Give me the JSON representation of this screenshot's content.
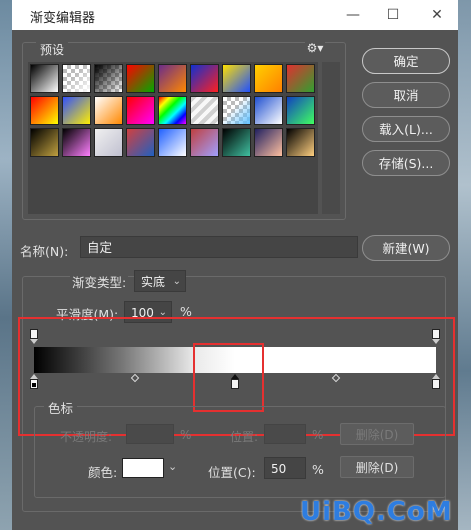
{
  "window": {
    "title": "渐变编辑器"
  },
  "presets": {
    "label": "预设",
    "gear_icon": "gear-icon",
    "rows": [
      [
        "#000000|#ffffff",
        "checker|#ffffff",
        "#000000|transparent",
        "#ff0000|#00aa00",
        "#6a2c8a|#ff8800",
        "#1030d0|#ff2020",
        "#ffe000|#2050ff",
        "#ffd000|#ff8000",
        "#e03030|#30a030"
      ],
      [
        "#ff0000|#ffff00",
        "#3050ff|#ffee00",
        "#ffffff|#ff8800",
        "#ff0000|#ff00ff",
        "rainbow",
        "stripes",
        "checker|#60c0ff",
        "#2050d0|#ffffff",
        "#1040c0|#40ff60"
      ],
      [
        "#000000|#c0a040",
        "#000000|#ff80ff",
        "#f0f0f0|#c0c0d0",
        "#d04040|#2060c0",
        "#2060ff|#ffffff",
        "#c04040|#a0a0ff",
        "#000000|#40c0a0",
        "#202060|#ffc0a0",
        "#000000|#ffd080"
      ]
    ]
  },
  "buttons": {
    "ok": "确定",
    "cancel": "取消",
    "load": "载入(L)...",
    "save": "存储(S)...",
    "new": "新建(W)"
  },
  "name": {
    "label": "名称(N):",
    "value": "自定"
  },
  "gradient": {
    "type_label": "渐变类型:",
    "type_value": "实底",
    "smooth_label": "平滑度(M):",
    "smooth_value": "100",
    "smooth_unit": "%",
    "color_stops": [
      {
        "location_percent": 0,
        "color": "#000000"
      },
      {
        "location_percent": 50,
        "color": "#ffffff"
      },
      {
        "location_percent": 100,
        "color": "#ffffff"
      }
    ],
    "opacity_stops": [
      {
        "location_percent": 0
      },
      {
        "location_percent": 100
      }
    ],
    "midpoints_percent": [
      25,
      75
    ]
  },
  "stops": {
    "label": "色标",
    "opacity_label": "不透明度:",
    "opacity_unit": "%",
    "location_label_top": "位置:",
    "location_unit_top": "%",
    "delete_top": "删除(D)",
    "color_label": "颜色:",
    "color_value": "#ffffff",
    "location_label": "位置(C):",
    "location_value": "50",
    "location_unit": "%",
    "delete": "删除(D)"
  },
  "watermark": "UiBQ.CoM"
}
